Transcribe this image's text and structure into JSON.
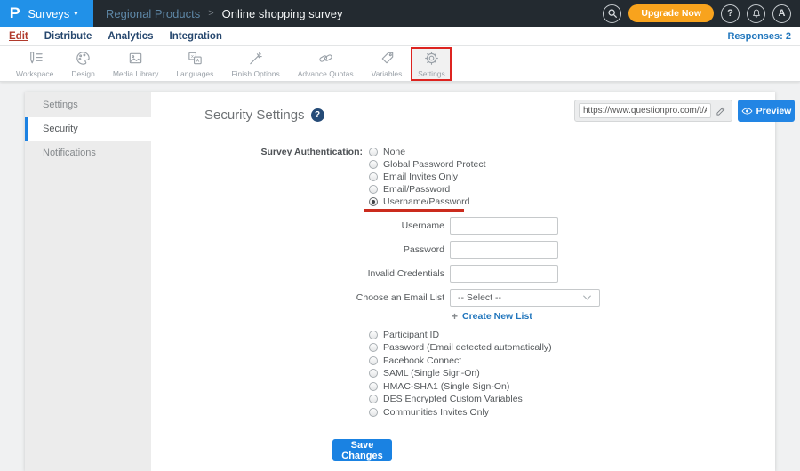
{
  "topbar": {
    "logo": "P",
    "app_menu": "Surveys",
    "caret": "▾",
    "breadcrumb": {
      "project": "Regional Products",
      "separator": ">",
      "current": "Online shopping survey"
    },
    "upgrade_label": "Upgrade Now",
    "help_label": "?",
    "avatar_label": "A"
  },
  "nav": {
    "items": [
      "Edit",
      "Distribute",
      "Analytics",
      "Integration"
    ],
    "active_item": "Edit",
    "responses": "Responses: 2"
  },
  "toolbar": {
    "items": [
      "Workspace",
      "Design",
      "Media Library",
      "Languages",
      "Finish Options",
      "Advance Quotas",
      "Variables",
      "Settings"
    ],
    "highlighted_item": "Settings",
    "url": "https://www.questionpro.com/t/APNrFZ",
    "preview_label": "Preview"
  },
  "sidebar": {
    "items": [
      "Settings",
      "Security",
      "Notifications"
    ],
    "active_item": "Security"
  },
  "main": {
    "title": "Security Settings",
    "help_glyph": "?",
    "auth_label": "Survey Authentication:",
    "auth_options_top": [
      "None",
      "Global Password Protect",
      "Email Invites Only",
      "Email/Password",
      "Username/Password"
    ],
    "selected_option": "Username/Password",
    "fields": [
      {
        "label": "Username",
        "value": ""
      },
      {
        "label": "Password",
        "value": ""
      },
      {
        "label": "Invalid Credentials",
        "value": ""
      }
    ],
    "email_list": {
      "label": "Choose an Email List",
      "value": "-- Select --"
    },
    "create_plus": "+",
    "create_link": "Create New List",
    "auth_options_bottom": [
      "Participant ID",
      "Password (Email detected automatically)",
      "Facebook Connect",
      "SAML (Single Sign-On)",
      "HMAC-SHA1 (Single Sign-On)",
      "DES Encrypted Custom Variables",
      "Communities Invites Only"
    ],
    "save_label": "Save Changes"
  },
  "colors": {
    "topbar_dark": "#232a30",
    "brand_blue": "#2191e8",
    "accent_blue": "#1a82e2",
    "brand_orange": "#f8a31d",
    "annotation_red": "#cb2b1d",
    "nav_red": "#b13a2c",
    "link_blue": "#2176bd"
  }
}
